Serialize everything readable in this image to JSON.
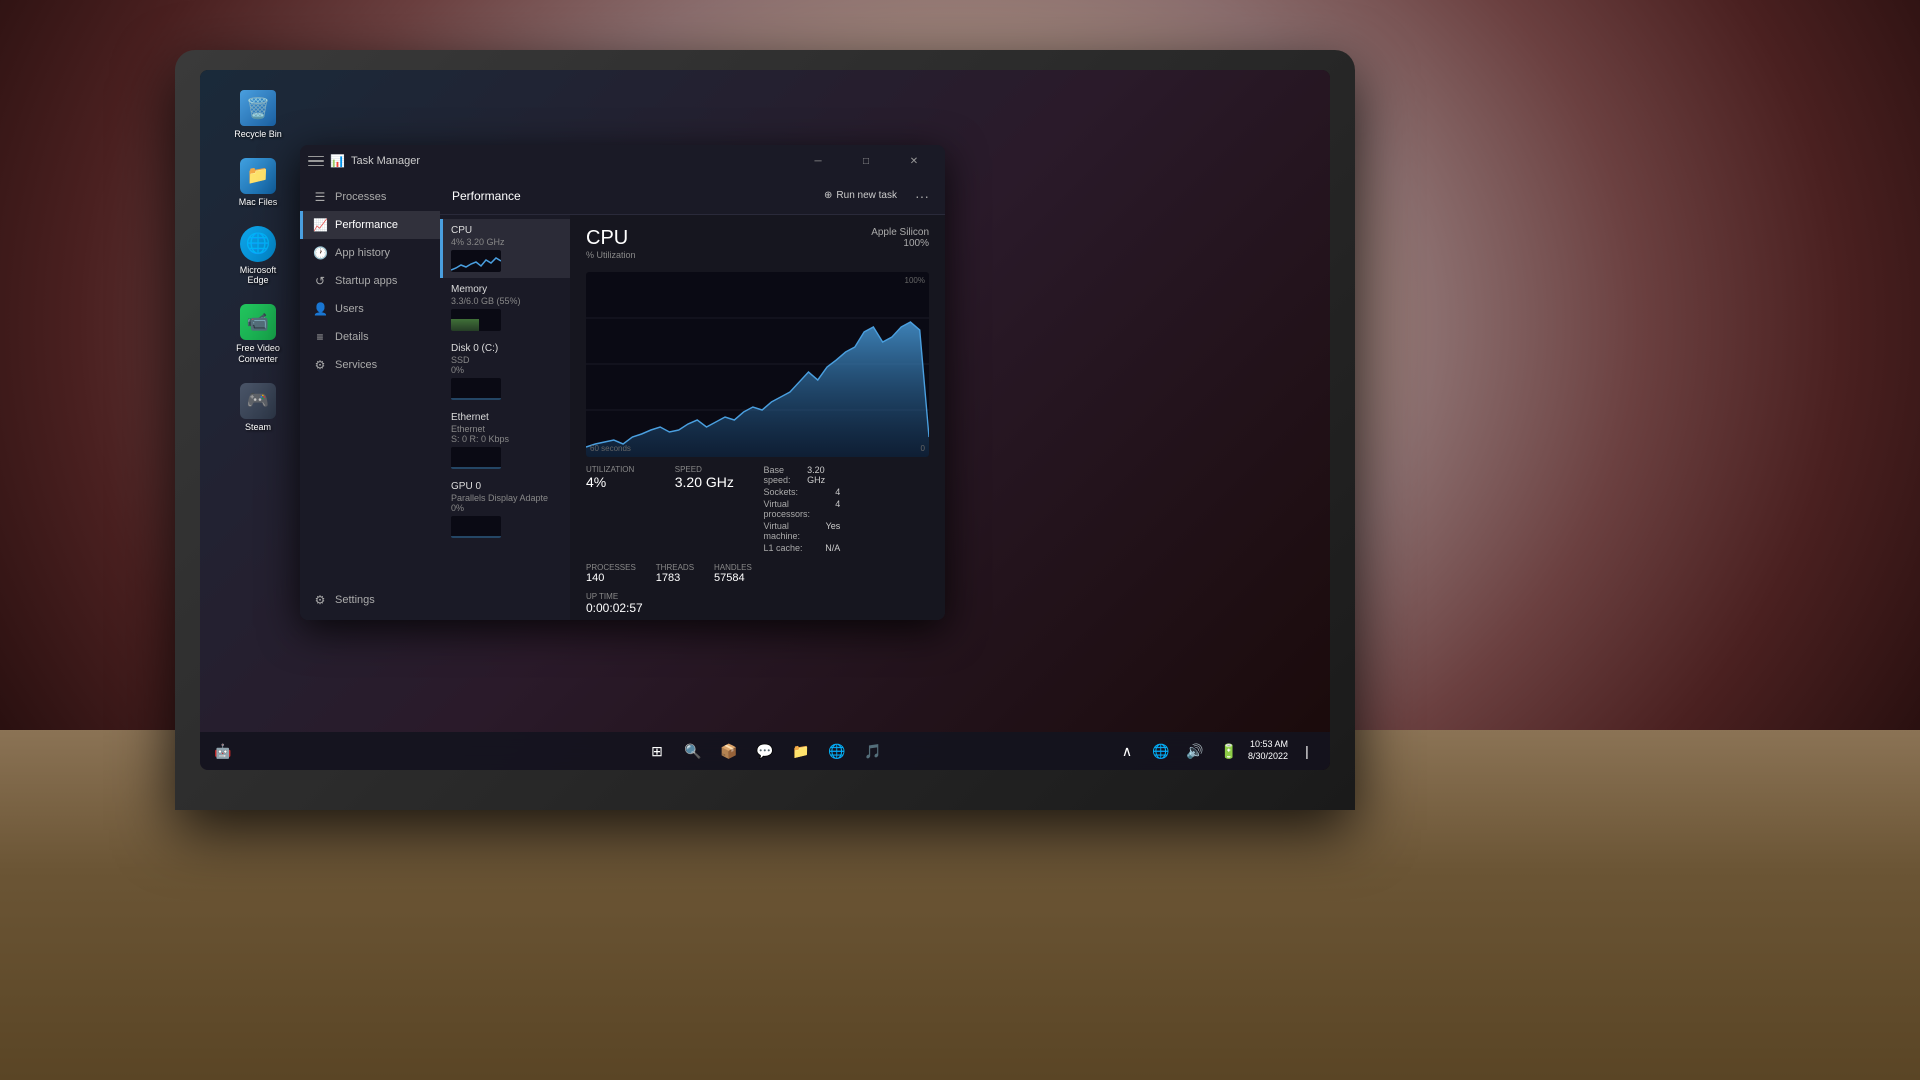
{
  "desktop": {
    "icons": [
      {
        "id": "recycle-bin",
        "label": "Recycle Bin",
        "emoji": "🗑️"
      },
      {
        "id": "mac-files",
        "label": "Mac Files",
        "emoji": "📁"
      },
      {
        "id": "microsoft-edge",
        "label": "Microsoft Edge",
        "emoji": "🌐"
      },
      {
        "id": "free-video-converter",
        "label": "Free Video Converter",
        "emoji": "📹"
      },
      {
        "id": "steam",
        "label": "Steam",
        "emoji": "🎮"
      }
    ]
  },
  "taskbar": {
    "time": "10:53 AM",
    "date": "8/30/2022",
    "center_icons": [
      "⊞",
      "🔍",
      "📦",
      "💬",
      "📁",
      "🌐",
      "🎵"
    ]
  },
  "task_manager": {
    "title": "Task Manager",
    "sidebar": {
      "items": [
        {
          "id": "processes",
          "label": "Processes",
          "icon": "☰"
        },
        {
          "id": "performance",
          "label": "Performance",
          "icon": "📊",
          "active": true
        },
        {
          "id": "app-history",
          "label": "App history",
          "icon": "🕐"
        },
        {
          "id": "startup-apps",
          "label": "Startup apps",
          "icon": "🚀"
        },
        {
          "id": "users",
          "label": "Users",
          "icon": "👤"
        },
        {
          "id": "details",
          "label": "Details",
          "icon": "📋"
        },
        {
          "id": "services",
          "label": "Services",
          "icon": "⚙️"
        }
      ],
      "footer": {
        "settings_label": "Settings"
      }
    },
    "performance": {
      "title": "Performance",
      "run_task_label": "Run new task",
      "devices": [
        {
          "id": "cpu",
          "name": "CPU",
          "sub": "4% 3.20 GHz",
          "active": true
        },
        {
          "id": "memory",
          "name": "Memory",
          "sub": "3.3/6.0 GB (55%)"
        },
        {
          "id": "disk0",
          "name": "Disk 0 (C:)",
          "sub": "SSD\n0%"
        },
        {
          "id": "ethernet",
          "name": "Ethernet",
          "sub": "Ethernet\nS: 0 R: 0 Kbps"
        },
        {
          "id": "gpu0",
          "name": "GPU 0",
          "sub": "Parallels Display Adapte\n0%"
        }
      ],
      "cpu": {
        "title": "CPU",
        "subtitle": "% Utilization",
        "model": "Apple Silicon",
        "usage_pct": "100%",
        "stats": {
          "utilization_label": "Utilization",
          "utilization_value": "4%",
          "speed_label": "Speed",
          "speed_value": "3.20 GHz",
          "processes_label": "Processes",
          "processes_value": "140",
          "threads_label": "Threads",
          "threads_value": "1783",
          "handles_label": "Handles",
          "handles_value": "57584"
        },
        "info": {
          "base_speed_label": "Base speed:",
          "base_speed_value": "3.20 GHz",
          "sockets_label": "Sockets:",
          "sockets_value": "4",
          "virtual_processors_label": "Virtual processors:",
          "virtual_processors_value": "4",
          "virtual_machine_label": "Virtual machine:",
          "virtual_machine_value": "Yes",
          "l1_cache_label": "L1 cache:",
          "l1_cache_value": "N/A"
        },
        "uptime_label": "Up time",
        "uptime_value": "0:00:02:57",
        "chart_seconds_label": "60 seconds",
        "chart_zero_label": "0"
      }
    }
  }
}
